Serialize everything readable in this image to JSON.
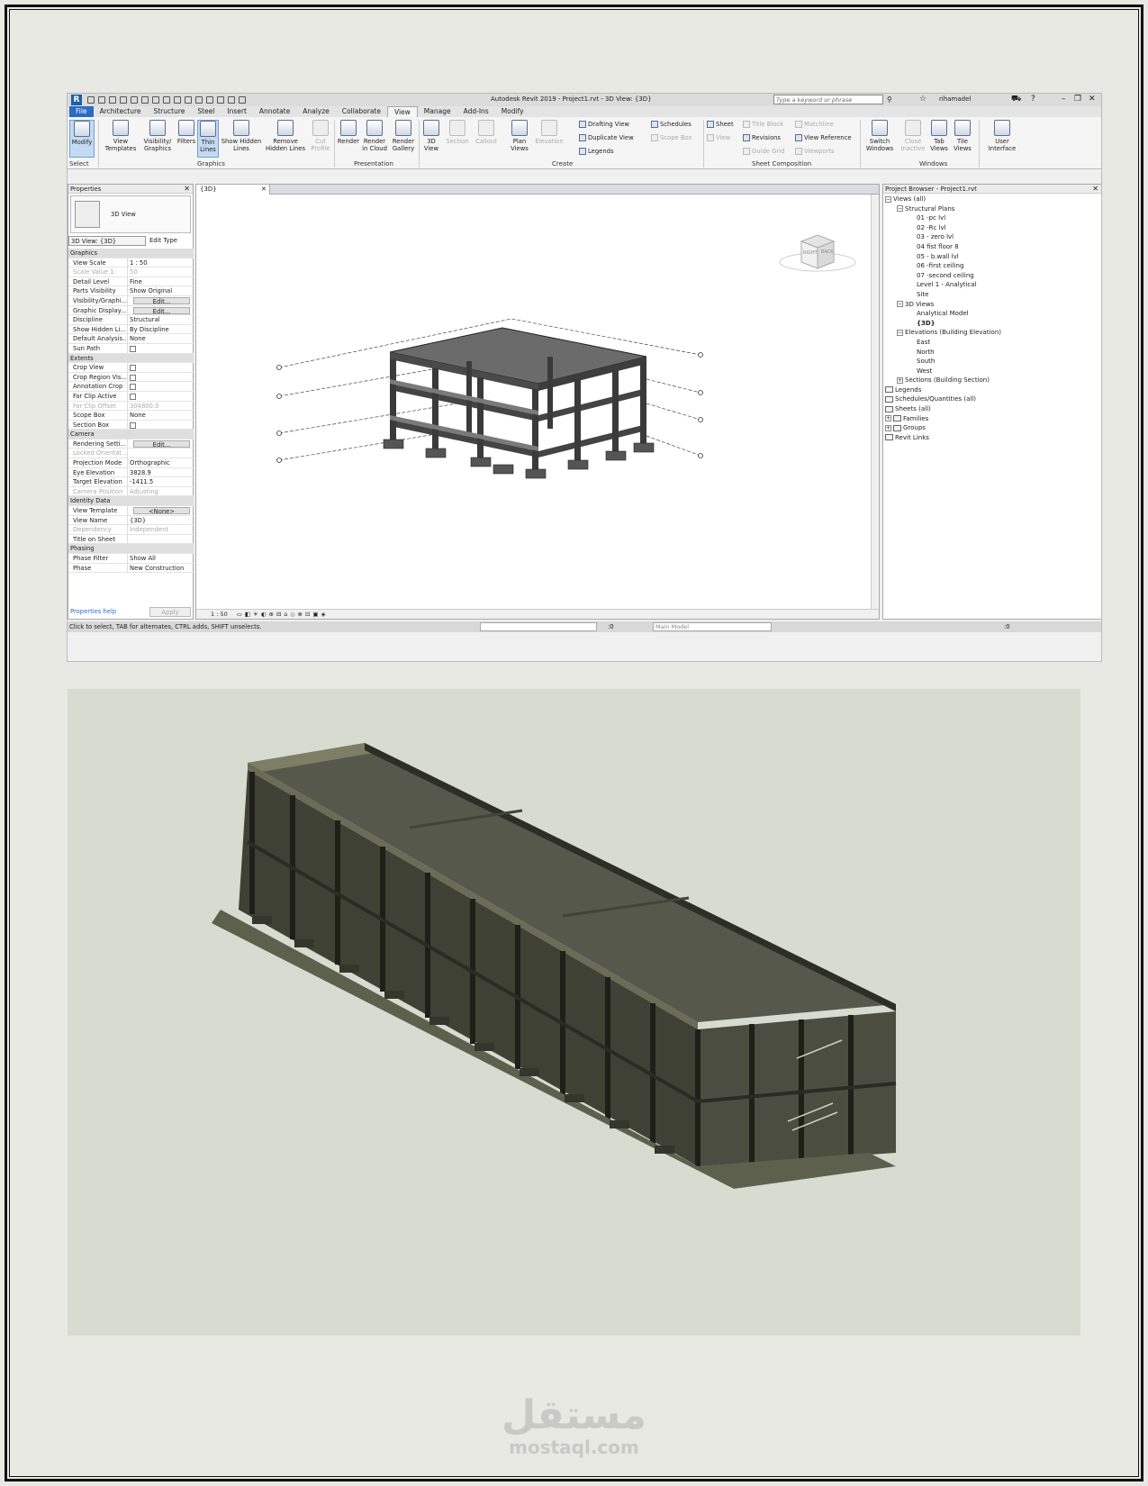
{
  "qat": {
    "app_letter": "R",
    "title": "Autodesk Revit 2019 - Project1.rvt - 3D View: {3D}",
    "search_placeholder": "Type a keyword or phrase",
    "user": "rihamadel"
  },
  "tabs": [
    "File",
    "Architecture",
    "Structure",
    "Steel",
    "Insert",
    "Annotate",
    "Analyze",
    "Collaborate",
    "View",
    "Manage",
    "Add-Ins",
    "Modify"
  ],
  "ribbon": {
    "modify": "Modify",
    "select": "Select",
    "view_templates": "View Templates",
    "visibility": "Visibility/ Graphics",
    "filters": "Filters",
    "thin_lines": "Thin Lines",
    "show_hidden": "Show Hidden Lines",
    "remove_hidden": "Remove Hidden Lines",
    "cut_profile": "Cut Profile",
    "graphics": "Graphics",
    "render": "Render",
    "render_cloud": "Render in Cloud",
    "render_gallery": "Render Gallery",
    "presentation": "Presentation",
    "view3d": "3D View",
    "section": "Section",
    "callout": "Callout",
    "plan_views": "Plan Views",
    "elevation": "Elevation",
    "drafting": "Drafting View",
    "duplicate": "Duplicate View",
    "legends": "Legends",
    "schedules": "Schedules",
    "scope_box": "Scope Box",
    "create": "Create",
    "sheet": "Sheet",
    "view": "View",
    "title_block": "Title Block",
    "revisions": "Revisions",
    "guide_grid": "Guide Grid",
    "matchline": "Matchline",
    "view_reference": "View Reference",
    "viewports": "Viewports",
    "sheet_comp": "Sheet Composition",
    "switch_windows": "Switch Windows",
    "close_inactive": "Close Inactive",
    "tab_views": "Tab Views",
    "tile_views": "Tile Views",
    "windows": "Windows",
    "user_interface": "User Interface"
  },
  "properties": {
    "title": "Properties",
    "type_name": "3D View",
    "selector": "3D View: {3D}",
    "edit_type": "Edit Type",
    "rows": [
      {
        "cat": "Graphics"
      },
      {
        "k": "View Scale",
        "v": "1 : 50"
      },
      {
        "k": "Scale Value    1:",
        "v": "50",
        "dis": true
      },
      {
        "k": "Detail Level",
        "v": "Fine"
      },
      {
        "k": "Parts Visibility",
        "v": "Show Original"
      },
      {
        "k": "Visibility/Graphi...",
        "btn": "Edit..."
      },
      {
        "k": "Graphic Display...",
        "btn": "Edit..."
      },
      {
        "k": "Discipline",
        "v": "Structural"
      },
      {
        "k": "Show Hidden Li...",
        "v": "By Discipline"
      },
      {
        "k": "Default Analysis...",
        "v": "None"
      },
      {
        "k": "Sun Path",
        "cb": true
      },
      {
        "cat": "Extents"
      },
      {
        "k": "Crop View",
        "cb": true
      },
      {
        "k": "Crop Region Vis...",
        "cb": true
      },
      {
        "k": "Annotation Crop",
        "cb": true
      },
      {
        "k": "Far Clip Active",
        "cb": true
      },
      {
        "k": "Far Clip Offset",
        "v": "304800.0",
        "dis": true
      },
      {
        "k": "Scope Box",
        "v": "None"
      },
      {
        "k": "Section Box",
        "cb": true
      },
      {
        "cat": "Camera"
      },
      {
        "k": "Rendering Setti...",
        "btn": "Edit..."
      },
      {
        "k": "Locked Orientat...",
        "v": "",
        "dis": true
      },
      {
        "k": "Projection Mode",
        "v": "Orthographic"
      },
      {
        "k": "Eye Elevation",
        "v": "3828.9"
      },
      {
        "k": "Target Elevation",
        "v": "-1411.5"
      },
      {
        "k": "Camera Position",
        "v": "Adjusting",
        "dis": true
      },
      {
        "cat": "Identity Data"
      },
      {
        "k": "View Template",
        "btn": "<None>"
      },
      {
        "k": "View Name",
        "v": "{3D}"
      },
      {
        "k": "Dependency",
        "v": "Independent",
        "dis": true
      },
      {
        "k": "Title on Sheet",
        "v": ""
      },
      {
        "cat": "Phasing"
      },
      {
        "k": "Phase Filter",
        "v": "Show All"
      },
      {
        "k": "Phase",
        "v": "New Construction"
      }
    ],
    "help": "Properties help",
    "apply": "Apply"
  },
  "view": {
    "tab": "{3D}",
    "scale": "1 : 50",
    "cube_right": "RIGHT",
    "cube_back": "BACK"
  },
  "browser": {
    "title": "Project Browser - Project1.rvt",
    "items": [
      {
        "t": "Views (all)",
        "lvl": 0,
        "tog": "−"
      },
      {
        "t": "Structural Plans",
        "lvl": 1,
        "tog": "−"
      },
      {
        "t": "01 -pc lvl",
        "lvl": 2
      },
      {
        "t": "02 -Rc lvl",
        "lvl": 2
      },
      {
        "t": "03 - zero lvl",
        "lvl": 2
      },
      {
        "t": "04 fist floor 8",
        "lvl": 2
      },
      {
        "t": "05 - b.wall lvl",
        "lvl": 2
      },
      {
        "t": "06 -first ceiling",
        "lvl": 2
      },
      {
        "t": "07 -second ceiling",
        "lvl": 2
      },
      {
        "t": "Level 1 - Analytical",
        "lvl": 2
      },
      {
        "t": "Site",
        "lvl": 2
      },
      {
        "t": "3D Views",
        "lvl": 1,
        "tog": "−"
      },
      {
        "t": "Analytical Model",
        "lvl": 2
      },
      {
        "t": "{3D}",
        "lvl": 2,
        "bold": true
      },
      {
        "t": "Elevations (Building Elevation)",
        "lvl": 1,
        "tog": "−"
      },
      {
        "t": "East",
        "lvl": 2
      },
      {
        "t": "North",
        "lvl": 2
      },
      {
        "t": "South",
        "lvl": 2
      },
      {
        "t": "West",
        "lvl": 2
      },
      {
        "t": "Sections (Building Section)",
        "lvl": 1,
        "tog": "+"
      },
      {
        "t": "Legends",
        "lvl": 0,
        "icon": true
      },
      {
        "t": "Schedules/Quantities (all)",
        "lvl": 0,
        "icon": true
      },
      {
        "t": "Sheets (all)",
        "lvl": 0,
        "icon": true
      },
      {
        "t": "Families",
        "lvl": 0,
        "tog": "+",
        "icon": true
      },
      {
        "t": "Groups",
        "lvl": 0,
        "tog": "+",
        "icon": true
      },
      {
        "t": "Revit Links",
        "lvl": 0,
        "icon": true
      }
    ]
  },
  "status": {
    "hint": "Click to select, TAB for alternates, CTRL adds, SHIFT unselects.",
    "zero": ":0",
    "model": "Main Model",
    "filter": ":0"
  },
  "watermark": {
    "arabic": "مستقل",
    "latin": "mostaql.com"
  }
}
